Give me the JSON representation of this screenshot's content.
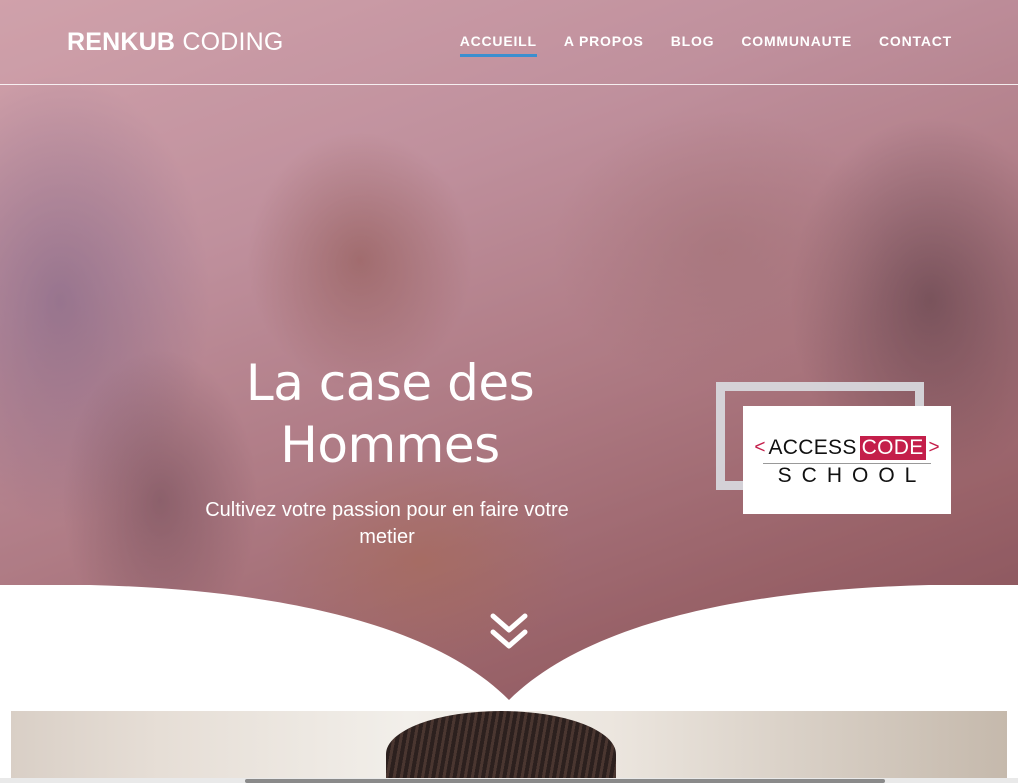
{
  "header": {
    "logo_bold": "RENKUB",
    "logo_light": "CODING",
    "nav": [
      {
        "label": "ACCUEILL",
        "active": true
      },
      {
        "label": "A PROPOS",
        "active": false
      },
      {
        "label": "BLOG",
        "active": false
      },
      {
        "label": "COMMUNAUTE",
        "active": false
      },
      {
        "label": "CONTACT",
        "active": false
      }
    ]
  },
  "hero": {
    "title_line1": "La case des",
    "title_line2": "Hommes",
    "subtitle_line1": "Cultivez votre passion pour en faire votre",
    "subtitle_line2": "metier"
  },
  "badge": {
    "bracket_left": "<",
    "word1": "ACCESS",
    "word2": "CODE",
    "bracket_right": ">",
    "word3": "SCHOOL"
  },
  "scroll_icon": "double-chevron-down-icon",
  "colors": {
    "accent": "#3a8fd0",
    "badge_red": "#c41e4a",
    "text_light": "#ffffff"
  }
}
